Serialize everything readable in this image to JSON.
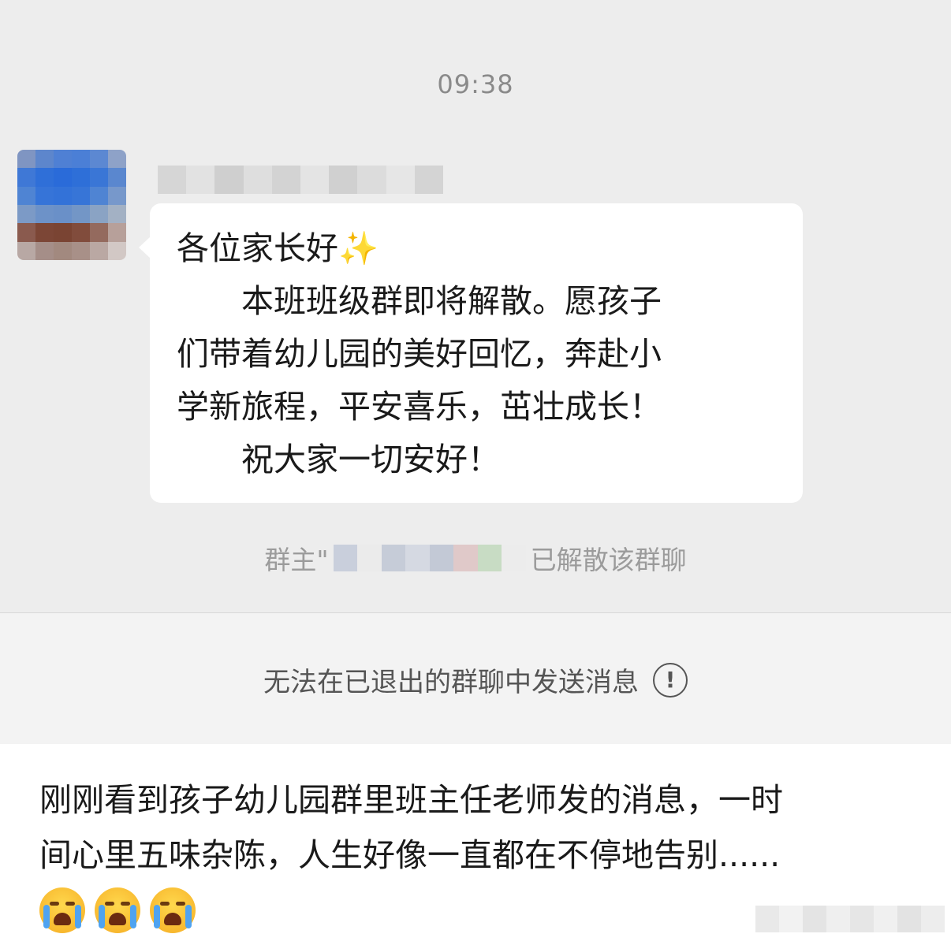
{
  "chat": {
    "timestamp": "09:38",
    "message": {
      "greeting": "各位家长好",
      "line1": "本班班级群即将解散。愿孩子",
      "line2": "们带着幼儿园的美好回忆，奔赴小",
      "line3": "学新旅程，平安喜乐，茁壮成长！",
      "line4": "祝大家一切安好！"
    },
    "system_notice_prefix": "群主\"",
    "system_notice_suffix": "已解散该群聊"
  },
  "footer": {
    "cannot_send_text": "无法在已退出的群聊中发送消息",
    "alert_icon": "!"
  },
  "caption": {
    "line1": "刚刚看到孩子幼儿园群里班主任老师发的消息，一时",
    "line2": "间心里五味杂陈，人生好像一直都在不停地告别......"
  },
  "icons": {
    "avatar": "pixelated-avatar",
    "sparkle": "sparkles-icon",
    "alert": "exclamation-circle-icon",
    "emoji": "loudly-crying-face-icon"
  },
  "colors": {
    "chat_background": "#ededed",
    "bubble": "#ffffff",
    "notice_text": "#9b9b9b"
  }
}
